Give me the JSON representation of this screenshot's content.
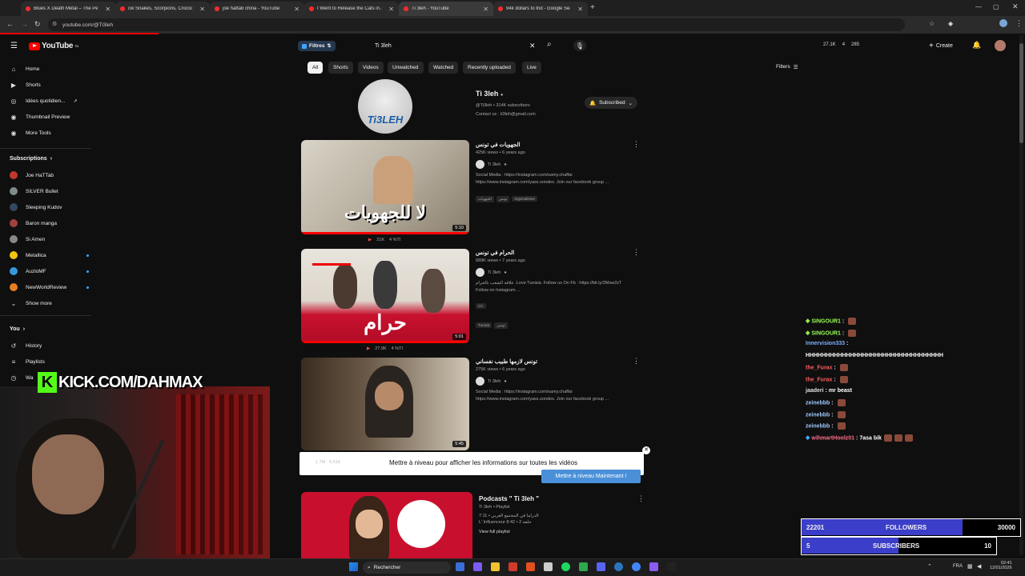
{
  "browser": {
    "tabs": [
      {
        "label": "Blues X Death Metal – The Perfe",
        "active": false
      },
      {
        "label": "cw Snakes, Scorpions, Crocodil",
        "active": false
      },
      {
        "label": "joe hattab china - YouTube",
        "active": false
      },
      {
        "label": "I Went to Release the Cats in Af",
        "active": false
      },
      {
        "label": "Ti 3leh - YouTube",
        "active": true
      },
      {
        "label": "94k dollars to tnd - Google Sear",
        "active": false
      }
    ],
    "new_tab": "+",
    "url": "youtube.com/@Ti3leh"
  },
  "youtube": {
    "logo": "YouTube",
    "logo_sup": "TN",
    "filters_chip": "Filtres",
    "search_value": "Ti 3leh",
    "header_stats": [
      "27.1K",
      "4",
      "285"
    ],
    "create_label": "Create",
    "sidebar": {
      "main": [
        {
          "label": "Home",
          "icon": "home-icon"
        },
        {
          "label": "Shorts",
          "icon": "shorts-icon"
        },
        {
          "label": "Idées quotidien...",
          "icon": "idea-icon"
        },
        {
          "label": "Thumbnail Preview",
          "icon": "thumbnail-icon"
        },
        {
          "label": "More Tools",
          "icon": "tools-icon"
        }
      ],
      "subscriptions_title": "Subscriptions",
      "subscriptions": [
        {
          "label": "Joe HaTTab",
          "color": "#c0392b",
          "dot": false
        },
        {
          "label": "SILVER Bullet",
          "color": "#7f8c8d",
          "dot": false
        },
        {
          "label": "Sleeping Kudov",
          "color": "#34495e",
          "dot": false
        },
        {
          "label": "Baron manga",
          "color": "#a04040",
          "dot": false
        },
        {
          "label": "Si Amen",
          "color": "#888888",
          "dot": false
        },
        {
          "label": "Metallica",
          "color": "#f1c40f",
          "dot": true
        },
        {
          "label": "AuzioMF",
          "color": "#3498db",
          "dot": true
        },
        {
          "label": "NewWorldReview",
          "color": "#e67e22",
          "dot": true
        }
      ],
      "show_more": "Show more",
      "you_title": "You",
      "you_items": [
        {
          "label": "History",
          "icon": "history-icon"
        },
        {
          "label": "Playlists",
          "icon": "playlist-icon"
        },
        {
          "label": "Wa",
          "icon": "watch-later-icon"
        }
      ]
    },
    "chips": [
      "All",
      "Shorts",
      "Videos",
      "Unwatched",
      "Watched",
      "Recently uploaded",
      "Live"
    ],
    "filters_right": "Filters",
    "channel": {
      "name": "Ti 3leh",
      "handle": "@Ti3leh • 314K subscribers",
      "contact": "Contact us : ti3leh@gmail.com",
      "subscribed": "Subscribed"
    },
    "videos": [
      {
        "title": "الجهويات في تونس",
        "meta": "425K views • 6 years ago",
        "channel": "Ti 3leh",
        "desc": [
          "Social Media : https://instagram.com/samy.chaffai",
          "https://www.instagram.com/yass.sondes. Join our facebook group ..."
        ],
        "tags": [
          "الجهويات",
          "تونس",
          "regionalisme"
        ],
        "duration": "5:10",
        "thumb_text": "لا للجهويات",
        "stat": "21K",
        "stat2": "4 %TI"
      },
      {
        "title": "الحرام في تونس",
        "meta": "689K views • 7 years ago",
        "channel": "Ti 3leh",
        "desc": [
          "علاقة الشعب بالحرام .Love Tunisia. Follow us On Fb : https://bit.ly/2Mxw2zT",
          "Follow on Instagram ..."
        ],
        "tags": [
          "Tunisia",
          "تونس"
        ],
        "cc": "CC",
        "duration": "5:01",
        "thumb_text": "حرام",
        "stat": "27.9K",
        "stat2": "4 %TI"
      },
      {
        "title": "تونس لازمها طبيب نفساني",
        "meta": "275K views • 6 years ago",
        "channel": "Ti 3leh",
        "desc": [
          "Social Media : https://instagram.com/samy.chaffai",
          "https://www.instagram.com/yass.sondes. Join our facebook group ..."
        ],
        "duration": "5:45"
      }
    ],
    "upgrade": {
      "left": "1.7M · 0.61K",
      "text": "Mettre à niveau pour afficher les informations sur toutes les vidéos",
      "button": "Mettre à niveau Maintenant !"
    },
    "playlist": {
      "title": "Podcasts \" Ti 3leh \"",
      "sub": "Ti 3leh • Playlist",
      "line1": "7:11 • الدراما في المجتمع العربي",
      "line2": "L' Influenceur 8:42 • 2 حلقة",
      "view": "View full playlist"
    }
  },
  "overlay": {
    "kick": "KICK.COM/DAHMAX",
    "kick_logo": "K",
    "chat": [
      {
        "user": "SINGOUR1",
        "color": "#9cff57",
        "msg": "",
        "emotes": 1
      },
      {
        "user": "SINGOUR1",
        "color": "#9cff57",
        "msg": "",
        "emotes": 1
      },
      {
        "user": "Innervision333",
        "color": "#7db2ff",
        "msg": "",
        "emotes": 0
      },
      {
        "user": "",
        "color": "#ffffff",
        "msg": "HHHHHHHHHHHHHHHHHHHHHHHHHHHHHHHHHH",
        "emotes": 0
      },
      {
        "user": "the_Furax",
        "color": "#ff5c5c",
        "msg": "",
        "emotes": 1
      },
      {
        "user": "the_Furax",
        "color": "#ff5c5c",
        "msg": "",
        "emotes": 1
      },
      {
        "user": "jaaderi",
        "color": "#e0e0e0",
        "msg": "mr beast",
        "emotes": 0
      },
      {
        "user": "zeinebbb",
        "color": "#9ec8ff",
        "msg": "",
        "emotes": 1
      },
      {
        "user": "zeinebbb",
        "color": "#9ec8ff",
        "msg": "",
        "emotes": 1
      },
      {
        "user": "zeinebbb",
        "color": "#9ec8ff",
        "msg": "",
        "emotes": 1
      },
      {
        "user": "wihmartHoolz01",
        "color": "#ff6f8a",
        "msg": "7asa bik",
        "emotes": 3
      }
    ],
    "followers": {
      "current": "22201",
      "label": "FOLLOWERS",
      "goal": "30000",
      "progress": 0.74
    },
    "subscribers": {
      "current": "5",
      "label": "SUBSCRIBERS",
      "goal": "10",
      "progress": 0.5
    }
  },
  "taskbar": {
    "search": "Rechercher",
    "lang": "FRA",
    "time": "02:41",
    "date": "12/01/2026"
  }
}
